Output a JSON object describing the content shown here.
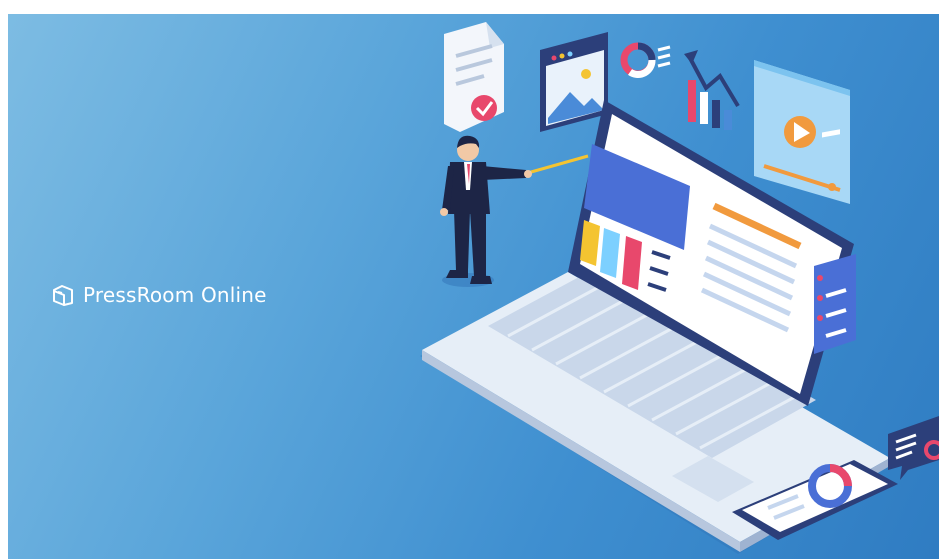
{
  "brand": {
    "name": "PressRoom Online",
    "logo_icon": "pressroom-logo-mark",
    "text_color": "#ffffff"
  },
  "background": {
    "gradient_light": "#7dbce3",
    "gradient_dark": "#2f7cc2"
  },
  "illustration": {
    "subject": "presenter-with-laptop",
    "palette": {
      "laptop_body": "#e6eef7",
      "screen_frame": "#2c3f7a",
      "screen_bg": "#ffffff",
      "accent_blue": "#4a6fd6",
      "accent_yellow": "#f4c431",
      "accent_pink": "#e8486c",
      "accent_orange": "#f19a3e",
      "suit": "#1d2546"
    }
  }
}
